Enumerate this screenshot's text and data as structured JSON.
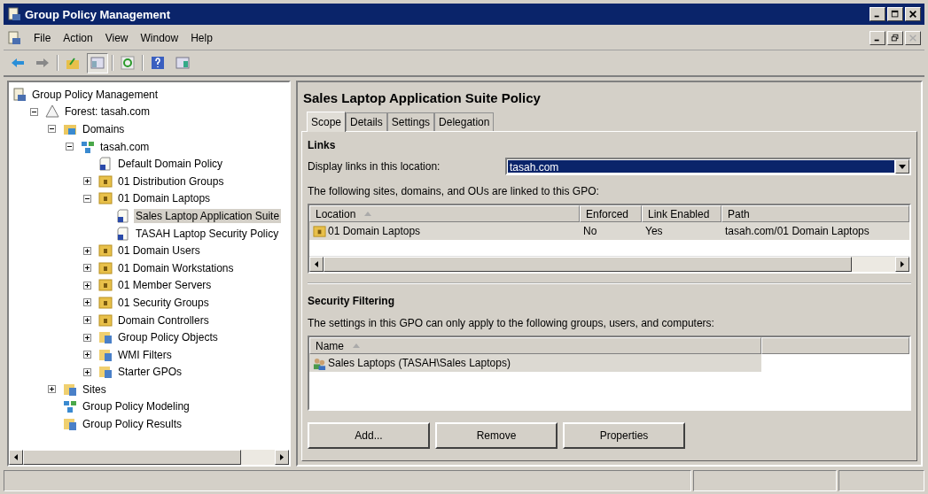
{
  "window": {
    "title": "Group Policy Management"
  },
  "menu": [
    "File",
    "Action",
    "View",
    "Window",
    "Help"
  ],
  "toolbar": [
    {
      "kind": "back",
      "pressed": false
    },
    {
      "kind": "forward",
      "pressed": false
    },
    {
      "kind": "sep"
    },
    {
      "kind": "up",
      "pressed": false
    },
    {
      "kind": "tree-toggle",
      "pressed": true
    },
    {
      "kind": "sep"
    },
    {
      "kind": "refresh",
      "pressed": false
    },
    {
      "kind": "sep"
    },
    {
      "kind": "help",
      "pressed": false
    },
    {
      "kind": "pane-toggle",
      "pressed": false
    }
  ],
  "mdi_buttons": [
    {
      "kind": "minimize",
      "disabled": false
    },
    {
      "kind": "restore",
      "disabled": false
    },
    {
      "kind": "close",
      "disabled": true
    }
  ],
  "tree": {
    "items": [
      {
        "label": "Group Policy Management",
        "kind": "root",
        "selected": false,
        "children": [
          {
            "label": "Forest: tasah.com",
            "kind": "forest",
            "expanded": true,
            "selected": false,
            "children": [
              {
                "label": "Domains",
                "kind": "domains",
                "expanded": true,
                "selected": false,
                "children": [
                  {
                    "label": "tasah.com",
                    "kind": "domain",
                    "expanded": true,
                    "selected": false,
                    "children": [
                      {
                        "label": "Default Domain Policy",
                        "kind": "gpo",
                        "selected": false
                      },
                      {
                        "label": "01 Distribution Groups",
                        "kind": "ou",
                        "expanded": false,
                        "selected": false
                      },
                      {
                        "label": "01 Domain Laptops",
                        "kind": "ou",
                        "expanded": true,
                        "selected": false,
                        "children": [
                          {
                            "label": "Sales Laptop Application Suite",
                            "kind": "gpo",
                            "selected": true
                          },
                          {
                            "label": "TASAH Laptop Security Policy",
                            "kind": "gpo",
                            "selected": false
                          }
                        ]
                      },
                      {
                        "label": "01 Domain Users",
                        "kind": "ou",
                        "expanded": false,
                        "selected": false
                      },
                      {
                        "label": "01 Domain Workstations",
                        "kind": "ou",
                        "expanded": false,
                        "selected": false
                      },
                      {
                        "label": "01 Member Servers",
                        "kind": "ou",
                        "expanded": false,
                        "selected": false
                      },
                      {
                        "label": "01 Security Groups",
                        "kind": "ou",
                        "expanded": false,
                        "selected": false
                      },
                      {
                        "label": "Domain Controllers",
                        "kind": "ou",
                        "expanded": false,
                        "selected": false
                      },
                      {
                        "label": "Group Policy Objects",
                        "kind": "container",
                        "expanded": false,
                        "selected": false
                      },
                      {
                        "label": "WMI Filters",
                        "kind": "filter",
                        "expanded": false,
                        "selected": false
                      },
                      {
                        "label": "Starter GPOs",
                        "kind": "starter",
                        "expanded": false,
                        "selected": false
                      }
                    ]
                  }
                ]
              },
              {
                "label": "Sites",
                "kind": "sites",
                "expanded": false,
                "selected": false
              },
              {
                "label": "Group Policy Modeling",
                "kind": "modeling",
                "selected": false
              },
              {
                "label": "Group Policy Results",
                "kind": "results",
                "selected": false
              }
            ]
          }
        ]
      }
    ]
  },
  "detail": {
    "title": "Sales Laptop Application Suite Policy",
    "tabs": [
      {
        "label": "Scope",
        "selected": true
      },
      {
        "label": "Details",
        "selected": false
      },
      {
        "label": "Settings",
        "selected": false
      },
      {
        "label": "Delegation",
        "selected": false
      }
    ],
    "links": {
      "heading": "Links",
      "location_label": "Display links in this location:",
      "location_value": "tasah.com",
      "description": "The following sites, domains, and OUs are linked to this GPO:",
      "columns": [
        {
          "label": "Location",
          "sorted": true
        },
        {
          "label": "Enforced",
          "sorted": false
        },
        {
          "label": "Link Enabled",
          "sorted": false
        },
        {
          "label": "Path",
          "sorted": false
        }
      ],
      "rows": [
        {
          "cells": [
            "01 Domain Laptops",
            "No",
            "Yes",
            "tasah.com/01 Domain Laptops"
          ],
          "selected": true
        }
      ]
    },
    "security": {
      "heading": "Security Filtering",
      "description": "The settings in this GPO can only apply to the following groups, users, and computers:",
      "columns": [
        {
          "label": "Name",
          "sorted": true
        }
      ],
      "rows": [
        {
          "name": "Sales Laptops (TASAH\\Sales Laptops)",
          "selected": true
        }
      ],
      "buttons": [
        "Add...",
        "Remove",
        "Properties"
      ]
    }
  }
}
